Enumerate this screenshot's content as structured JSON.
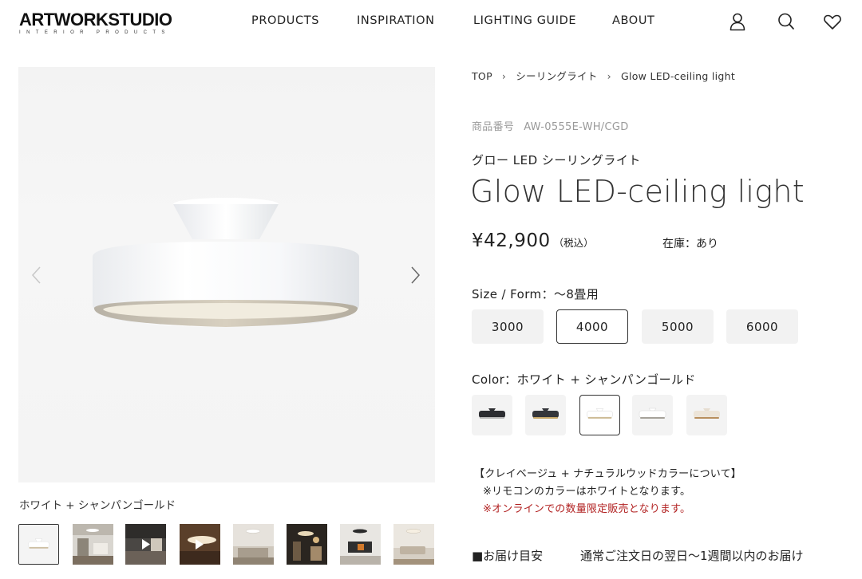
{
  "header": {
    "logo_main": "ARTWORKSTUDIO",
    "logo_sub": "INTERIOR PRODUCTS",
    "nav": [
      "PRODUCTS",
      "INSPIRATION",
      "LIGHTING GUIDE",
      "ABOUT"
    ],
    "icons": [
      "user-icon",
      "search-icon",
      "heart-icon"
    ]
  },
  "gallery": {
    "caption": "ホワイト + シャンパンゴールド",
    "prev_icon": "chevron-left-icon",
    "next_icon": "chevron-right-icon",
    "thumb_count": 8,
    "active_thumb": 1
  },
  "breadcrumb": [
    "TOP",
    "シーリングライト",
    "Glow LED-ceiling light"
  ],
  "product": {
    "sku_label": "商品番号",
    "sku": "AW-0555E-WH/CGD",
    "subtitle": "グロー LED シーリングライト",
    "title": "Glow LED-ceiling light",
    "price": "¥42,900",
    "tax": "（税込）",
    "stock": "在庫：あり"
  },
  "size": {
    "label": "Size / Form：〜8畳用",
    "options": [
      "3000",
      "4000",
      "5000",
      "6000"
    ],
    "selected": "4000"
  },
  "color": {
    "label": "Color：ホワイト + シャンパンゴールド",
    "swatches": [
      "black-silver",
      "black-gold",
      "white-champagne-gold",
      "white-silver",
      "clay-beige-natural-wood"
    ],
    "selected_index": 2
  },
  "notes": {
    "line1": "【クレイベージュ + ナチュラルウッドカラーについて】",
    "line2": "※リモコンのカラーはホワイトとなります。",
    "line3": "※オンラインでの数量限定販売となります。",
    "alert_color": "#b22222"
  },
  "delivery": {
    "label": "■お届け目安",
    "value": "通常ご注文日の翌日〜1週間以内のお届け"
  }
}
